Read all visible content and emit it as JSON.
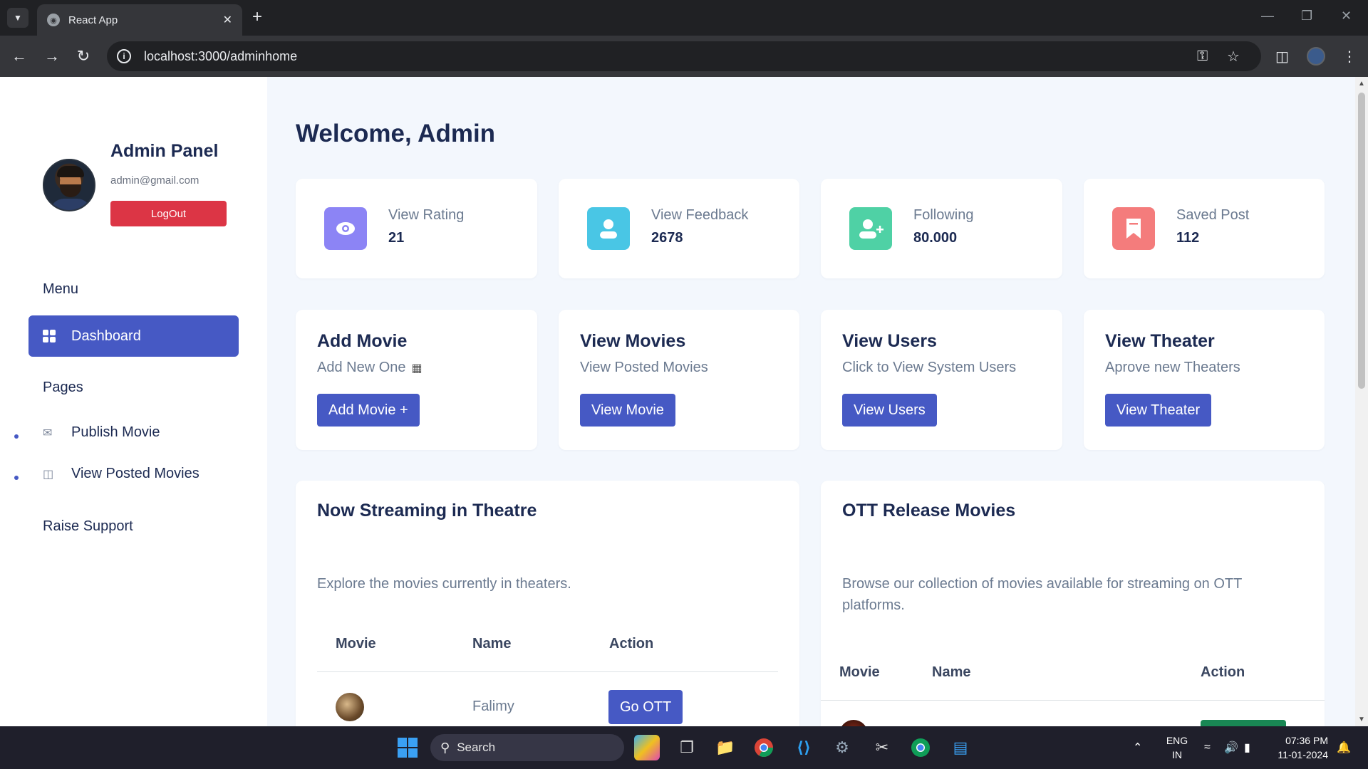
{
  "browser": {
    "tab_title": "React App",
    "url": "localhost:3000/adminhome"
  },
  "sidebar": {
    "title": "Admin Panel",
    "email": "admin@gmail.com",
    "logout_label": "LogOut",
    "menu_heading": "Menu",
    "dashboard_label": "Dashboard",
    "pages_heading": "Pages",
    "pages": [
      {
        "label": "Publish Movie",
        "icon": "envelope-icon"
      },
      {
        "label": "View Posted Movies",
        "icon": "basket-icon"
      }
    ],
    "support_label": "Raise Support"
  },
  "main": {
    "welcome": "Welcome, Admin",
    "stats": [
      {
        "label": "View Rating",
        "value": "21",
        "color": "#8c84f5",
        "icon": "eye-icon"
      },
      {
        "label": "View Feedback",
        "value": "2678",
        "color": "#49c6e5",
        "icon": "user-icon"
      },
      {
        "label": "Following",
        "value": "80.000",
        "color": "#4fd1a5",
        "icon": "user-plus-icon"
      },
      {
        "label": "Saved Post",
        "value": "112",
        "color": "#f47c7c",
        "icon": "bookmark-icon"
      }
    ],
    "actions": [
      {
        "title": "Add Movie",
        "subtitle": "Add New One",
        "button": "Add Movie +"
      },
      {
        "title": "View Movies",
        "subtitle": "View Posted Movies",
        "button": "View Movie"
      },
      {
        "title": "View Users",
        "subtitle": "Click to View System Users",
        "button": "View Users"
      },
      {
        "title": "View Theater",
        "subtitle": "Aprove new Theaters",
        "button": "View Theater"
      }
    ],
    "streaming": {
      "title": "Now Streaming in Theatre",
      "description": "Explore the movies currently in theaters.",
      "columns": [
        "Movie",
        "Name",
        "Action"
      ],
      "rows": [
        {
          "name": "Falimy",
          "action": "Go OTT"
        }
      ]
    },
    "ott": {
      "title": "OTT Release Movies",
      "description": "Browse our collection of movies available for streaming on OTT platforms.",
      "columns": [
        "Movie",
        "Name",
        "Action"
      ]
    }
  },
  "taskbar": {
    "search_placeholder": "Search",
    "lang_line1": "ENG",
    "lang_line2": "IN",
    "time": "07:36 PM",
    "date": "11-01-2024"
  }
}
